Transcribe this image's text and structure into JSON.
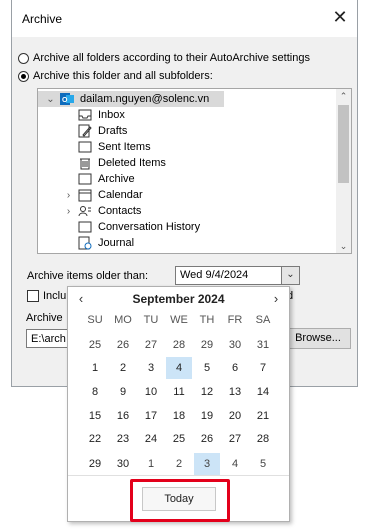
{
  "dialog": {
    "title": "Archive",
    "close_glyph": "✕",
    "radio_all": "Archive all folders according to their AutoArchive settings",
    "radio_this": "Archive this folder and all subfolders:",
    "selected_radio": "radio_this",
    "archive_older_label": "Archive items older than:",
    "date_value": "Wed 9/4/2024",
    "include_label": "Inclu",
    "include_tail": "d",
    "archive_file_label": "Archive",
    "archive_path": "E:\\arch",
    "browse_label": "Browse..."
  },
  "tree": {
    "account": "dailam.nguyen@solenc.vn",
    "folders": [
      {
        "name": "Inbox",
        "icon": "inbox-icon",
        "expandable": false
      },
      {
        "name": "Drafts",
        "icon": "drafts-icon",
        "expandable": false
      },
      {
        "name": "Sent Items",
        "icon": "sent-icon",
        "expandable": false
      },
      {
        "name": "Deleted Items",
        "icon": "trash-icon",
        "expandable": false
      },
      {
        "name": "Archive",
        "icon": "archive-icon",
        "expandable": false
      },
      {
        "name": "Calendar",
        "icon": "calendar-icon",
        "expandable": true
      },
      {
        "name": "Contacts",
        "icon": "contacts-icon",
        "expandable": true
      },
      {
        "name": "Conversation History",
        "icon": "folder-icon",
        "expandable": false
      },
      {
        "name": "Journal",
        "icon": "journal-icon",
        "expandable": false
      }
    ]
  },
  "calendar": {
    "month_label": "September 2024",
    "weekdays": [
      "SU",
      "MO",
      "TU",
      "WE",
      "TH",
      "FR",
      "SA"
    ],
    "weeks": [
      [
        "25",
        "26",
        "27",
        "28",
        "29",
        "30",
        "31"
      ],
      [
        "1",
        "2",
        "3",
        "4",
        "5",
        "6",
        "7"
      ],
      [
        "8",
        "9",
        "10",
        "11",
        "12",
        "13",
        "14"
      ],
      [
        "15",
        "16",
        "17",
        "18",
        "19",
        "20",
        "21"
      ],
      [
        "22",
        "23",
        "24",
        "25",
        "26",
        "27",
        "28"
      ],
      [
        "29",
        "30",
        "1",
        "2",
        "3",
        "4",
        "5"
      ]
    ],
    "selected_day": "4",
    "today_day": "3",
    "today_label": "Today"
  },
  "colors": {
    "highlight": "#e3001b",
    "selection": "#cce4f7",
    "account_icon": "#0f6cbd"
  }
}
